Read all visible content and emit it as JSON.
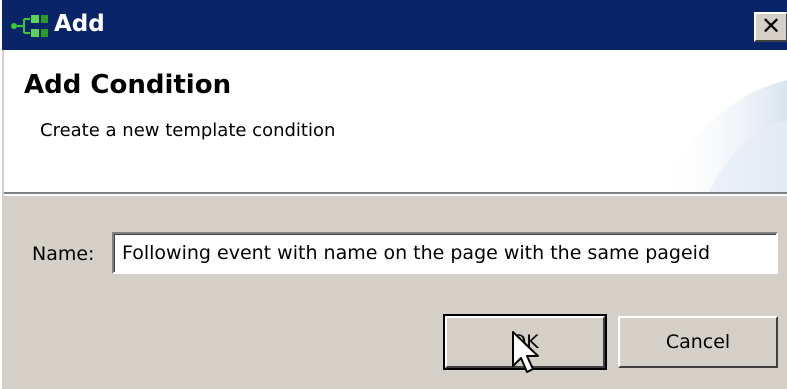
{
  "window": {
    "title": "Add",
    "icon": "template-condition-icon",
    "close_label": "✕"
  },
  "banner": {
    "heading": "Add Condition",
    "description": "Create a new template condition"
  },
  "form": {
    "name_label": "Name:",
    "name_value": "Following event with name on the page with the same pageid"
  },
  "buttons": {
    "ok_label": "OK",
    "cancel_label": "Cancel"
  },
  "colors": {
    "titlebar": "#0a246a",
    "dialog_face": "#d4d0c8",
    "banner_bg": "#ffffff"
  }
}
